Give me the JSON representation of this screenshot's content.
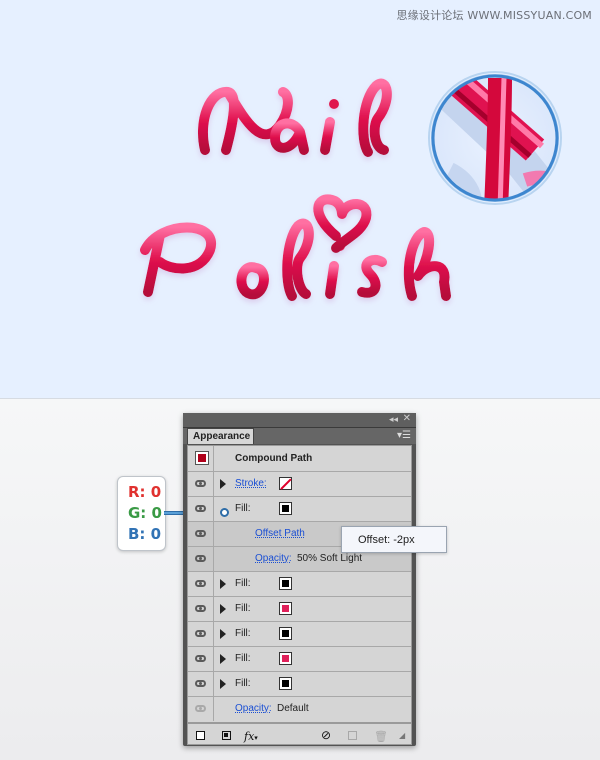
{
  "watermark": "思缘设计论坛 WWW.MISSYUAN.COM",
  "artwork": {
    "line1": "Nail",
    "line2": "Polish"
  },
  "panel": {
    "tab_label": "Appearance",
    "header_title": "Compound Path",
    "rows": [
      {
        "type": "stroke",
        "label": "Stroke:",
        "swatch": "none-stroke",
        "has_arrow": true,
        "eye": true
      },
      {
        "type": "fill",
        "label": "Fill:",
        "swatch": "#000000",
        "has_arrow": false,
        "eye": true
      },
      {
        "type": "effect",
        "label": "Offset Path",
        "eye": true
      },
      {
        "type": "opacity",
        "label": "Opacity:",
        "value": "50% Soft Light",
        "eye": true
      },
      {
        "type": "fill",
        "label": "Fill:",
        "swatch": "#000000",
        "has_arrow": true,
        "eye": true
      },
      {
        "type": "fill",
        "label": "Fill:",
        "swatch": "#e0205a",
        "has_arrow": true,
        "eye": true
      },
      {
        "type": "fill",
        "label": "Fill:",
        "swatch": "#000000",
        "has_arrow": true,
        "eye": true
      },
      {
        "type": "fill",
        "label": "Fill:",
        "swatch": "#e0205a",
        "has_arrow": true,
        "eye": true
      },
      {
        "type": "fill",
        "label": "Fill:",
        "swatch": "#000000",
        "has_arrow": true,
        "eye": true
      },
      {
        "type": "opacity",
        "label": "Opacity:",
        "value": "Default",
        "eye": false
      }
    ],
    "bottom_icons": [
      "add-stroke-icon",
      "add-fill-icon",
      "fx-icon",
      "clear-appearance-icon",
      "duplicate-item-icon",
      "delete-item-icon"
    ],
    "fx_label": "fx"
  },
  "rgb_callout": {
    "r": "R: 0",
    "g": "G: 0",
    "b": "B: 0",
    "r_color": "#e0312f",
    "g_color": "#3a9a45",
    "b_color": "#3173b5"
  },
  "offset_callout": "Offset: -2px"
}
